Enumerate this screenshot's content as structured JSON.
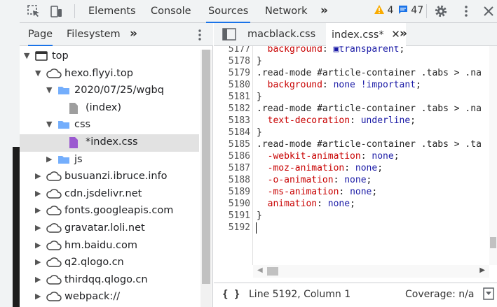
{
  "toolbar": {
    "tabs": [
      "Elements",
      "Console",
      "Sources",
      "Network"
    ],
    "active_tab": "Sources",
    "warnings": "4",
    "messages": "47",
    "icons": [
      "inspect-icon",
      "device-toggle-icon",
      "more-tabs-icon",
      "warning-icon",
      "message-icon",
      "settings-icon",
      "kebab-menu-icon",
      "close-icon"
    ]
  },
  "navigator": {
    "tabs": [
      "Page",
      "Filesystem"
    ],
    "active_tab": "Page",
    "tree": [
      {
        "label": "top",
        "type": "frame",
        "depth": 0,
        "expanded": true
      },
      {
        "label": "hexo.flyyi.top",
        "type": "cloud",
        "depth": 1,
        "expanded": true
      },
      {
        "label": "2020/07/25/wgbq",
        "type": "folder",
        "depth": 2,
        "expanded": true
      },
      {
        "label": "(index)",
        "type": "file-gray",
        "depth": 3
      },
      {
        "label": "css",
        "type": "folder",
        "depth": 2,
        "expanded": true
      },
      {
        "label": "*index.css",
        "type": "file-purple",
        "depth": 3,
        "selected": true
      },
      {
        "label": "js",
        "type": "folder",
        "depth": 2,
        "expanded": false
      },
      {
        "label": "busuanzi.ibruce.info",
        "type": "cloud",
        "depth": 1,
        "expanded": false
      },
      {
        "label": "cdn.jsdelivr.net",
        "type": "cloud",
        "depth": 1,
        "expanded": false
      },
      {
        "label": "fonts.googleapis.com",
        "type": "cloud",
        "depth": 1,
        "expanded": false
      },
      {
        "label": "gravatar.loli.net",
        "type": "cloud",
        "depth": 1,
        "expanded": false
      },
      {
        "label": "hm.baidu.com",
        "type": "cloud",
        "depth": 1,
        "expanded": false
      },
      {
        "label": "q2.qlogo.cn",
        "type": "cloud",
        "depth": 1,
        "expanded": false
      },
      {
        "label": "thirdqq.qlogo.cn",
        "type": "cloud",
        "depth": 1,
        "expanded": false
      },
      {
        "label": "webpack://",
        "type": "cloud",
        "depth": 1,
        "expanded": false
      }
    ]
  },
  "editor": {
    "tabs": [
      {
        "label": "macblack.css",
        "active": false
      },
      {
        "label": "index.css*",
        "active": true
      }
    ],
    "lines": [
      {
        "n": "5177",
        "parts": [
          [
            "pr",
            "  background"
          ],
          [
            "sel-c",
            ": "
          ],
          [
            "vl",
            "▣transparent"
          ],
          [
            "sel-c",
            ";"
          ]
        ]
      },
      {
        "n": "5178",
        "parts": [
          [
            "sel-c",
            "}"
          ]
        ]
      },
      {
        "n": "5179",
        "parts": [
          [
            "sel-c",
            ".read-mode #article-container .tabs > .na"
          ]
        ]
      },
      {
        "n": "5180",
        "parts": [
          [
            "pr",
            "  background"
          ],
          [
            "sel-c",
            ": "
          ],
          [
            "vl",
            "none !important"
          ],
          [
            "sel-c",
            ";"
          ]
        ]
      },
      {
        "n": "5181",
        "parts": [
          [
            "sel-c",
            "}"
          ]
        ]
      },
      {
        "n": "5182",
        "parts": [
          [
            "sel-c",
            ".read-mode #article-container .tabs > .na"
          ]
        ]
      },
      {
        "n": "5183",
        "parts": [
          [
            "pr",
            "  text-decoration"
          ],
          [
            "sel-c",
            ": "
          ],
          [
            "vl",
            "underline"
          ],
          [
            "sel-c",
            ";"
          ]
        ]
      },
      {
        "n": "5184",
        "parts": [
          [
            "sel-c",
            "}"
          ]
        ]
      },
      {
        "n": "5185",
        "parts": [
          [
            "sel-c",
            ".read-mode #article-container .tabs > .ta"
          ]
        ]
      },
      {
        "n": "5186",
        "parts": [
          [
            "pr",
            "  -webkit-animation"
          ],
          [
            "sel-c",
            ": "
          ],
          [
            "vl",
            "none"
          ],
          [
            "sel-c",
            ";"
          ]
        ]
      },
      {
        "n": "5187",
        "parts": [
          [
            "pr",
            "  -moz-animation"
          ],
          [
            "sel-c",
            ": "
          ],
          [
            "vl",
            "none"
          ],
          [
            "sel-c",
            ";"
          ]
        ]
      },
      {
        "n": "5188",
        "parts": [
          [
            "pr",
            "  -o-animation"
          ],
          [
            "sel-c",
            ": "
          ],
          [
            "vl",
            "none"
          ],
          [
            "sel-c",
            ";"
          ]
        ]
      },
      {
        "n": "5189",
        "parts": [
          [
            "pr",
            "  -ms-animation"
          ],
          [
            "sel-c",
            ": "
          ],
          [
            "vl",
            "none"
          ],
          [
            "sel-c",
            ";"
          ]
        ]
      },
      {
        "n": "5190",
        "parts": [
          [
            "pr",
            "  animation"
          ],
          [
            "sel-c",
            ": "
          ],
          [
            "vl",
            "none"
          ],
          [
            "sel-c",
            ";"
          ]
        ]
      },
      {
        "n": "5191",
        "parts": [
          [
            "sel-c",
            "}"
          ]
        ]
      },
      {
        "n": "5192",
        "parts": [
          [
            "sel-c",
            ""
          ]
        ]
      }
    ]
  },
  "status": {
    "braces": "{ }",
    "position": "Line 5192, Column 1",
    "coverage": "Coverage: n/a"
  },
  "colors": {
    "accent": "#1a73e8",
    "warning": "#f9ab00",
    "message": "#1a73e8",
    "folder": "#74aefc",
    "purple_file": "#9b59d0"
  }
}
